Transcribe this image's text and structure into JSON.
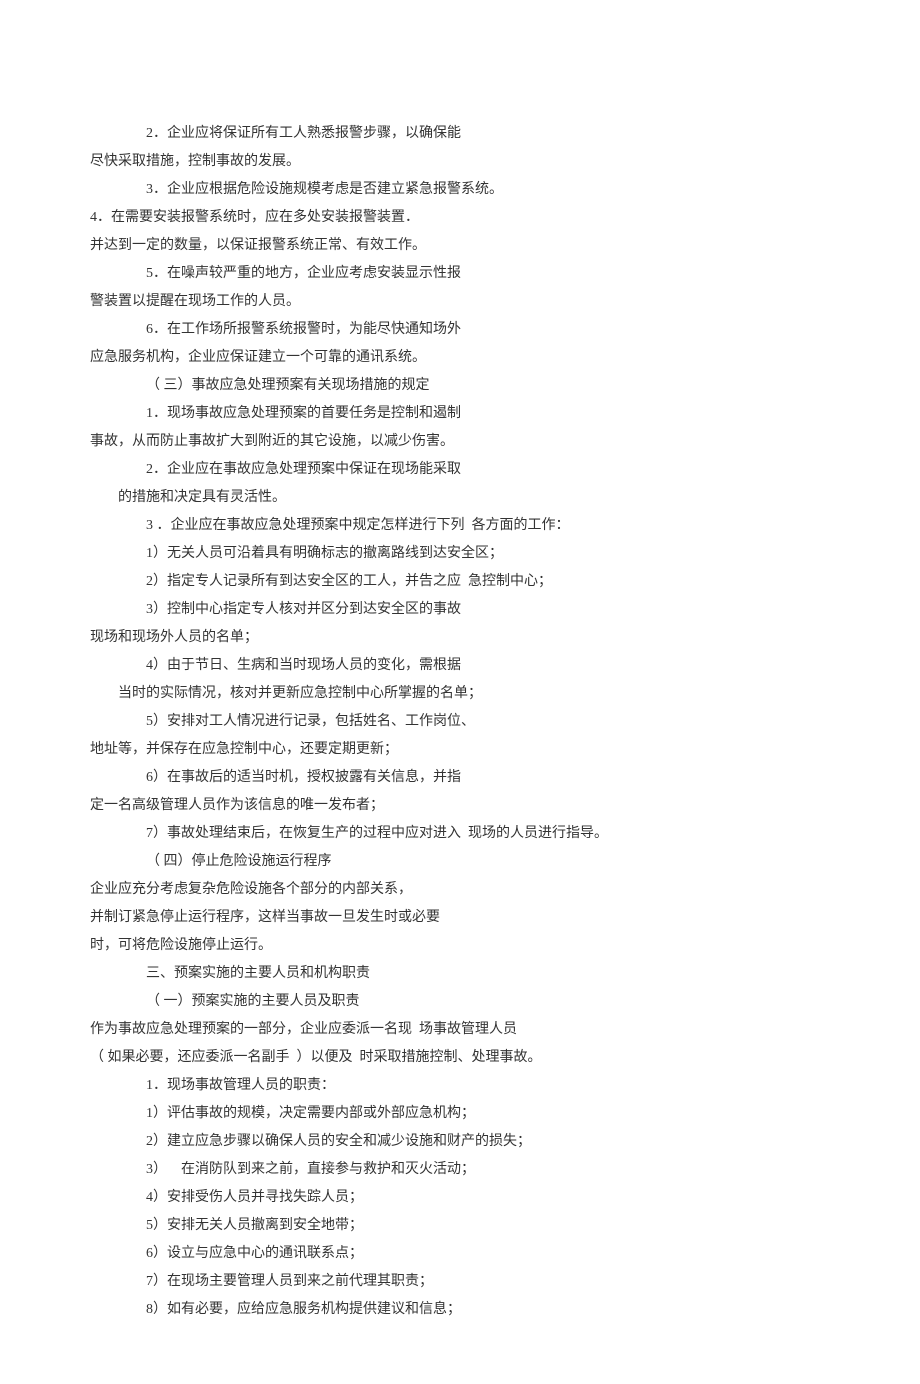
{
  "lines": [
    {
      "cls": "indent2",
      "text": "2．企业应将保证所有工人熟悉报警步骤，以确保能"
    },
    {
      "cls": "",
      "text": "尽快采取措施，控制事故的发展。"
    },
    {
      "cls": "indent2",
      "text": "3．企业应根据危险设施规模考虑是否建立紧急报警系统。"
    },
    {
      "cls": "",
      "text": "4．在需要安装报警系统时，应在多处安装报警装置．"
    },
    {
      "cls": "",
      "text": "并达到一定的数量，以保证报警系统正常、有效工作。"
    },
    {
      "cls": "indent2",
      "text": "5．在噪声较严重的地方，企业应考虑安装显示性报"
    },
    {
      "cls": "",
      "text": "警装置以提醒在现场工作的人员。"
    },
    {
      "cls": "indent2",
      "text": "6．在工作场所报警系统报警时，为能尽快通知场外"
    },
    {
      "cls": "",
      "text": "应急服务机构，企业应保证建立一个可靠的通讯系统。"
    },
    {
      "cls": "indent2",
      "text": "（ 三）事故应急处理预案有关现场措施的规定"
    },
    {
      "cls": "indent2",
      "text": "1．现场事故应急处理预案的首要任务是控制和遏制"
    },
    {
      "cls": "",
      "text": "事故，从而防止事故扩大到附近的其它设施，以减少伤害。"
    },
    {
      "cls": "indent2",
      "text": "2．企业应在事故应急处理预案中保证在现场能采取"
    },
    {
      "cls": "indent1",
      "text": "的措施和决定具有灵活性。"
    },
    {
      "cls": "indent2",
      "text": "3 ．企业应在事故应急处理预案中规定怎样进行下列  各方面的工作："
    },
    {
      "cls": "indent2",
      "text": "1）无关人员可沿着具有明确标志的撤离路线到达安全区；"
    },
    {
      "cls": "indent2",
      "text": "2）指定专人记录所有到达安全区的工人，并告之应  急控制中心；"
    },
    {
      "cls": "indent2",
      "text": "3）控制中心指定专人核对并区分到达安全区的事故"
    },
    {
      "cls": "",
      "text": "现场和现场外人员的名单；"
    },
    {
      "cls": "indent2",
      "text": "4）由于节日、生病和当时现场人员的变化，需根据"
    },
    {
      "cls": "indent1",
      "text": "当时的实际情况，核对并更新应急控制中心所掌握的名单；"
    },
    {
      "cls": "indent2",
      "text": "5）安排对工人情况进行记录，包括姓名、工作岗位、"
    },
    {
      "cls": "",
      "text": "地址等，并保存在应急控制中心，还要定期更新；"
    },
    {
      "cls": "indent2",
      "text": "6）在事故后的适当时机，授权披露有关信息，并指"
    },
    {
      "cls": "",
      "text": "定一名高级管理人员作为该信息的唯一发布者；"
    },
    {
      "cls": "indent2",
      "text": "7）事故处理结束后，在恢复生产的过程中应对进入  现场的人员进行指导。"
    },
    {
      "cls": "indent2",
      "text": "（ 四）停止危险设施运行程序"
    },
    {
      "cls": "",
      "text": "企业应充分考虑复杂危险设施各个部分的内部关系，"
    },
    {
      "cls": "",
      "text": "并制订紧急停止运行程序，这样当事故一旦发生时或必要"
    },
    {
      "cls": "",
      "text": "时，可将危险设施停止运行。"
    },
    {
      "cls": "indent2",
      "text": "三、预案实施的主要人员和机构职责"
    },
    {
      "cls": "indent2",
      "text": "（ 一）预案实施的主要人员及职责"
    },
    {
      "cls": "",
      "text": "作为事故应急处理预案的一部分，企业应委派一名现  场事故管理人员"
    },
    {
      "cls": "",
      "text": "（ 如果必要，还应委派一名副手  ）以便及  时采取措施控制、处理事故。"
    },
    {
      "cls": "indent2",
      "text": "1．现场事故管理人员的职责："
    },
    {
      "cls": "indent2",
      "text": "1）评估事故的规模，决定需要内部或外部应急机构；"
    },
    {
      "cls": "indent2",
      "text": "2）建立应急步骤以确保人员的安全和减少设施和财产的损失；"
    },
    {
      "cls": "indent2",
      "text": "3）    在消防队到来之前，直接参与救护和灭火活动；"
    },
    {
      "cls": "indent2",
      "text": "4）安排受伤人员并寻找失踪人员；"
    },
    {
      "cls": "indent2",
      "text": "5）安排无关人员撤离到安全地带；"
    },
    {
      "cls": "indent2",
      "text": "6）设立与应急中心的通讯联系点；"
    },
    {
      "cls": "indent2",
      "text": "7）在现场主要管理人员到来之前代理其职责；"
    },
    {
      "cls": "indent2",
      "text": "8）如有必要，应给应急服务机构提供建议和信息；"
    }
  ]
}
